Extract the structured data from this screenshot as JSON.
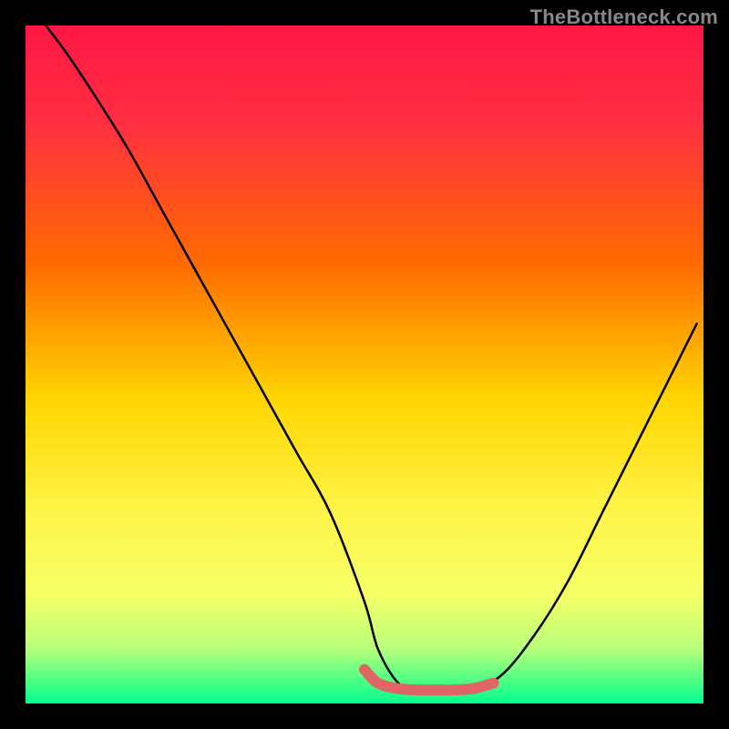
{
  "watermark": "TheBottleneck.com",
  "colors": {
    "black": "#000000",
    "gradient_top": "#ff1744",
    "gradient_mid_upper": "#ff6a00",
    "gradient_mid": "#ffd500",
    "gradient_mid_lower": "#f6ff66",
    "gradient_lower": "#b6ff7a",
    "gradient_bottom": "#00ff8c",
    "curve": "#000000",
    "accent": "#e06666"
  },
  "chart_data": {
    "type": "line",
    "title": "",
    "xlabel": "",
    "ylabel": "",
    "xlim": [
      0,
      100
    ],
    "ylim": [
      0,
      100
    ],
    "grid": false,
    "legend": false,
    "series": [
      {
        "name": "bottleneck-curve",
        "x": [
          3,
          6,
          10,
          15,
          20,
          25,
          30,
          35,
          40,
          45,
          50,
          52,
          55,
          58,
          60,
          65,
          70,
          75,
          80,
          85,
          90,
          95,
          99
        ],
        "y": [
          100,
          96,
          90,
          82,
          73,
          64,
          55,
          46,
          37,
          28,
          15,
          8,
          3,
          2,
          2,
          2,
          4,
          10,
          18,
          28,
          38,
          48,
          56
        ]
      }
    ],
    "accent_segment": {
      "name": "valley-highlight",
      "x": [
        50,
        52,
        55,
        58,
        60,
        63,
        66,
        69
      ],
      "y": [
        5,
        3,
        2.2,
        2,
        2,
        2,
        2.2,
        3
      ]
    }
  }
}
